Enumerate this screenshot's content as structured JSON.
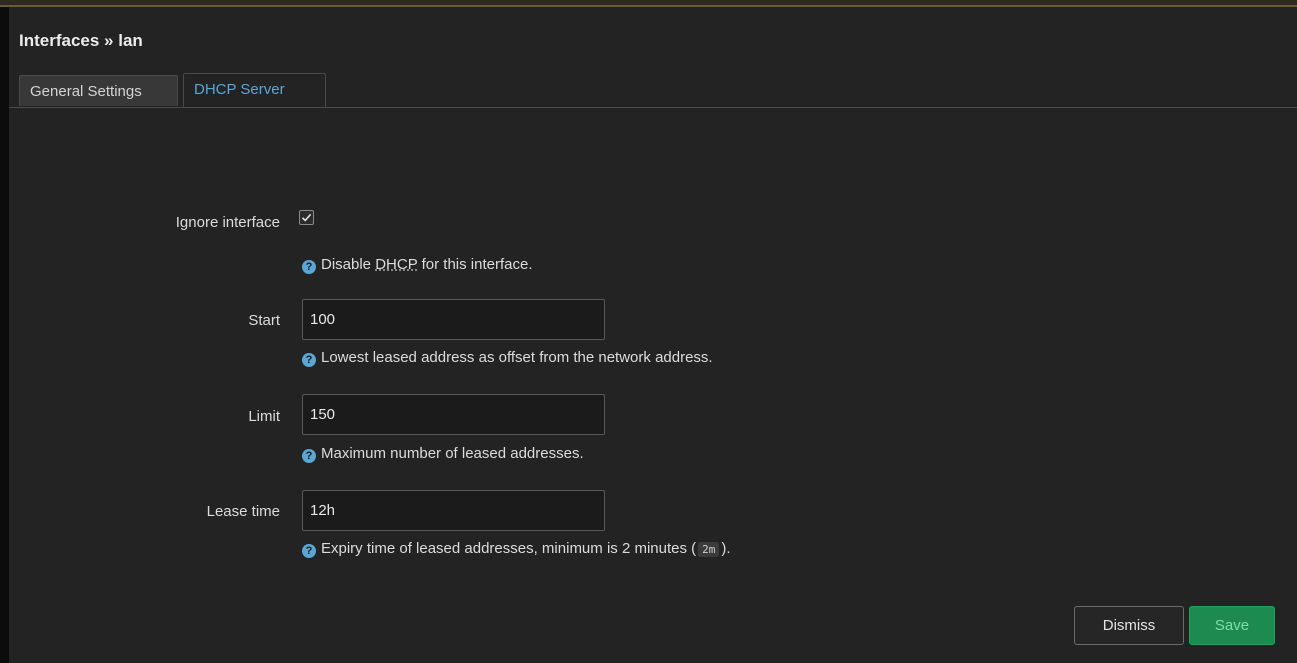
{
  "title": "Interfaces » lan",
  "tabs": [
    {
      "label": "General Settings",
      "active": false
    },
    {
      "label": "DHCP Server",
      "active": true
    }
  ],
  "fields": {
    "ignore": {
      "label": "Ignore interface",
      "checked": true,
      "help_pre": "Disable ",
      "help_abbr": "DHCP",
      "help_post": " for this interface."
    },
    "start": {
      "label": "Start",
      "value": "100",
      "help": "Lowest leased address as offset from the network address."
    },
    "limit": {
      "label": "Limit",
      "value": "150",
      "help": "Maximum number of leased addresses."
    },
    "leasetime": {
      "label": "Lease time",
      "value": "12h",
      "help_pre": "Expiry time of leased addresses, minimum is 2 minutes (",
      "help_code": "2m",
      "help_post": ")."
    }
  },
  "buttons": {
    "dismiss": "Dismiss",
    "save": "Save"
  },
  "colors": {
    "accent": "#55a8d7",
    "save_bg": "#1d8a4f",
    "panel_bg": "#232323"
  },
  "icons": {
    "help": "question-circle-icon",
    "check": "check-icon"
  }
}
